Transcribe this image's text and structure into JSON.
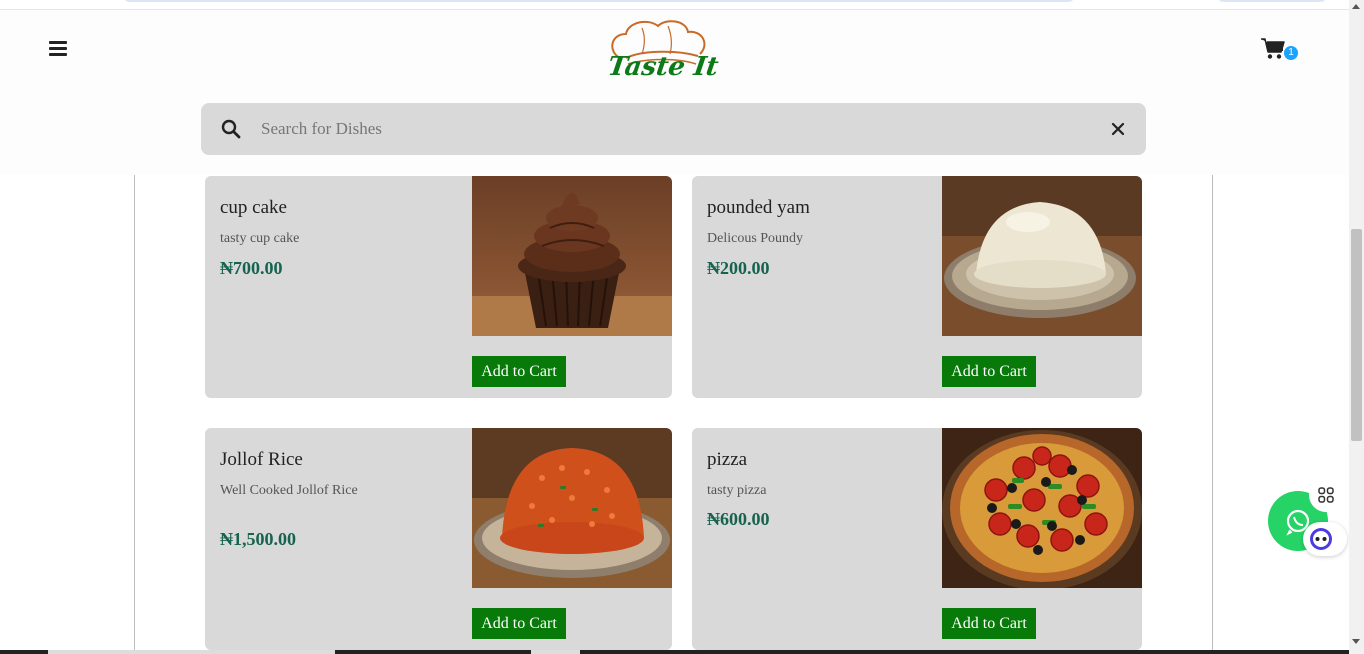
{
  "header": {
    "brand": "Taste It",
    "cart_count": "1"
  },
  "search": {
    "placeholder": "Search for Dishes",
    "value": ""
  },
  "products": [
    {
      "name": "cup cake",
      "description": "tasty cup cake",
      "price": "₦700.00",
      "button": "Add to Cart",
      "image": "chocolate cupcake"
    },
    {
      "name": "pounded yam",
      "description": "Delicous Poundy",
      "price": "₦200.00",
      "button": "Add to Cart",
      "image": "pounded yam on plate"
    },
    {
      "name": "Jollof Rice",
      "description": "Well Cooked Jollof Rice",
      "price": "₦1,500.00",
      "button": "Add to Cart",
      "image": "jollof rice on plate"
    },
    {
      "name": "pizza",
      "description": "tasty pizza",
      "price": "₦600.00",
      "button": "Add to Cart",
      "image": "pepperoni pizza"
    }
  ],
  "icons": {
    "menu": "hamburger-menu-icon",
    "cart": "shopping-cart-icon",
    "search": "search-icon",
    "clear": "close-icon",
    "whatsapp": "whatsapp-icon",
    "apps": "apps-grid-icon",
    "bot": "chat-bot-icon"
  },
  "colors": {
    "button_green": "#087a0a",
    "price_green": "#16634e",
    "card_bg": "#d9d9d9",
    "badge_blue": "#1aa3ff",
    "whatsapp_green": "#25d366"
  }
}
